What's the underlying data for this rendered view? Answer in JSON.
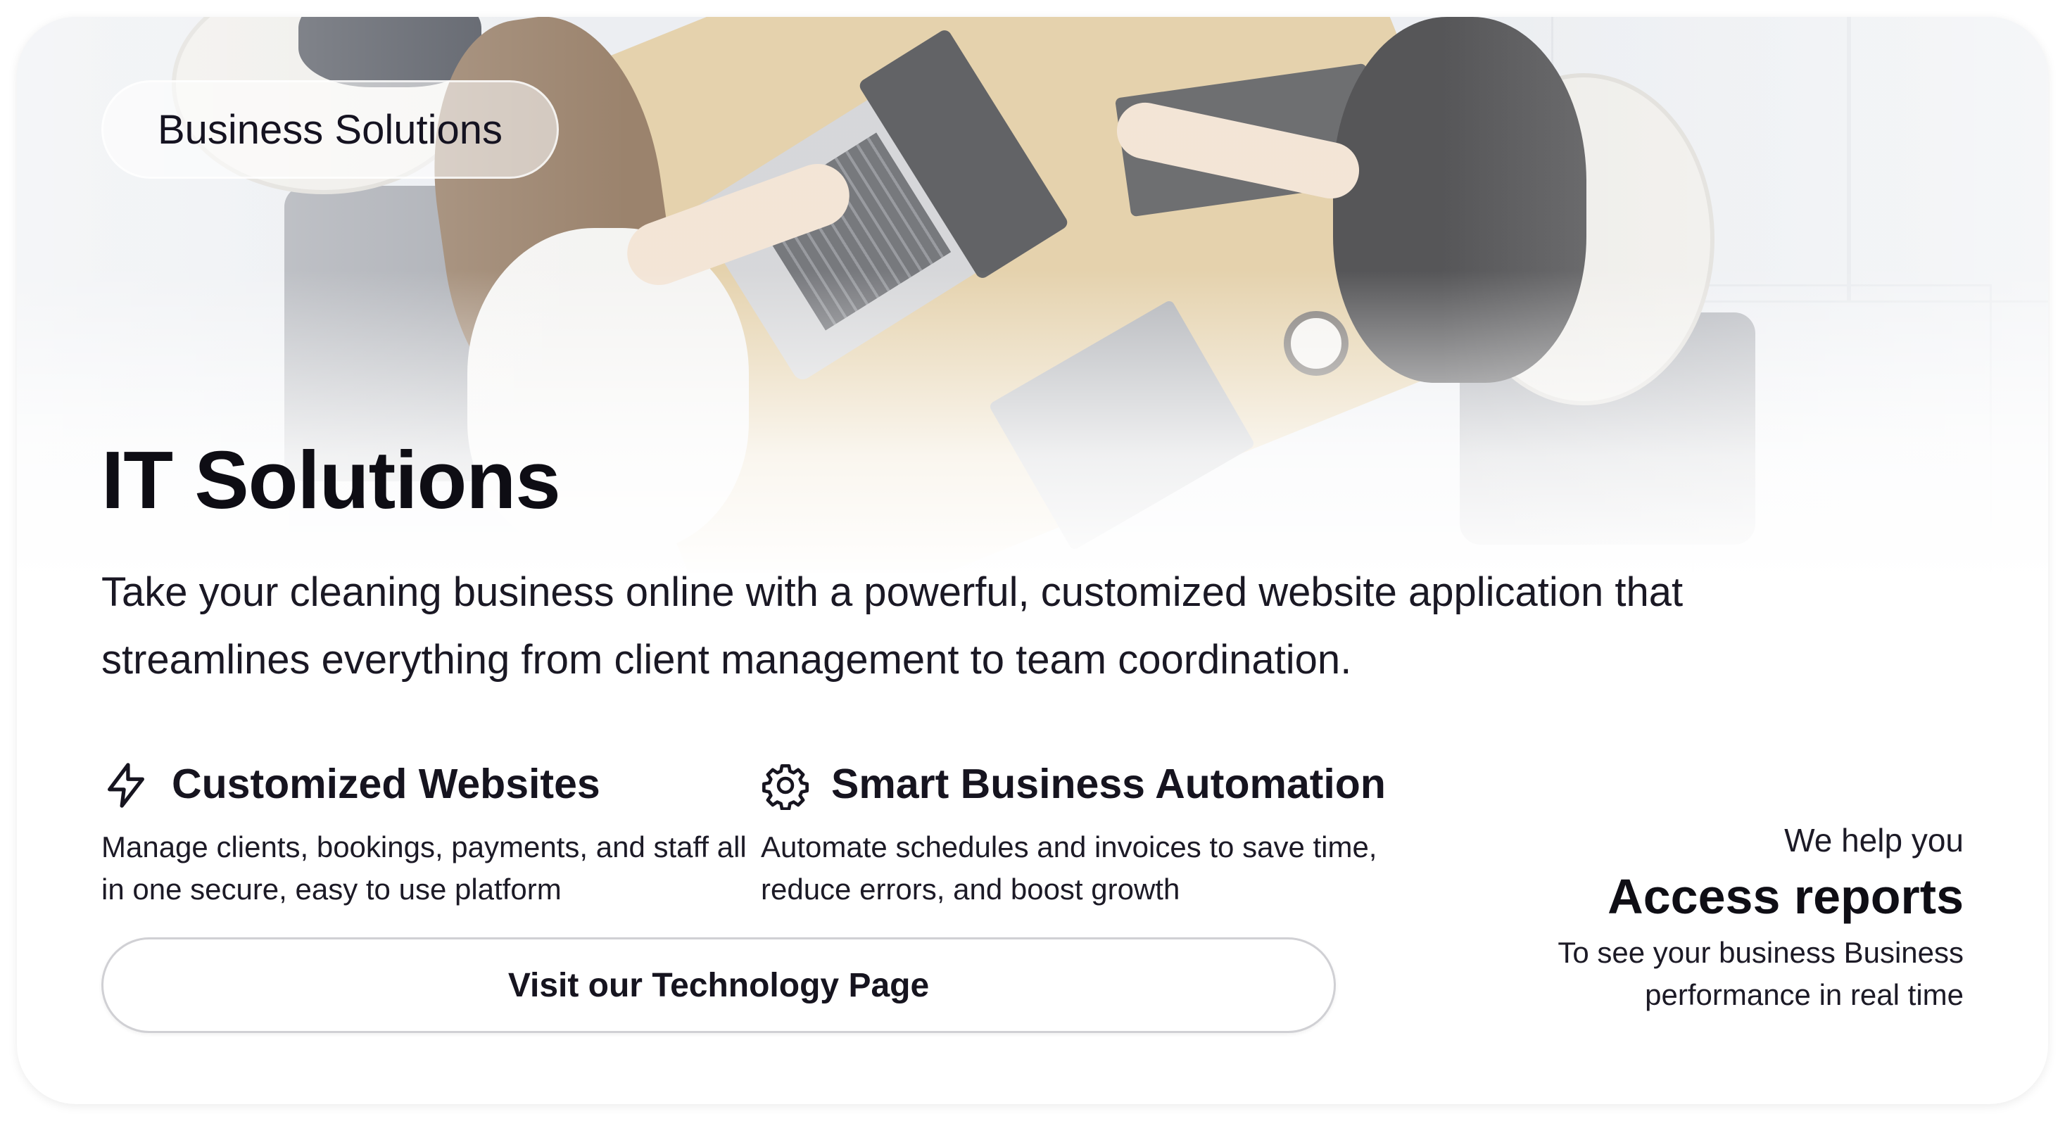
{
  "badge": {
    "label": "Business Solutions"
  },
  "hero": {
    "title": "IT Solutions",
    "description": "Take your cleaning business online with a powerful, customized website application that streamlines everything from client management to team coordination."
  },
  "features": [
    {
      "icon": "lightning-bolt-icon",
      "title": "Customized Websites",
      "description": "Manage clients, bookings, payments, and staff all in one secure, easy to use platform"
    },
    {
      "icon": "gear-icon",
      "title": "Smart Business Automation",
      "description": "Automate schedules and invoices to save time, reduce errors, and boost growth"
    }
  ],
  "cta": {
    "label": "Visit our Technology Page"
  },
  "highlight": {
    "kicker": "We help you",
    "headline": "Access reports",
    "subtext": "To see your business Business performance in real time"
  },
  "colors": {
    "text": "#14121c",
    "border": "#d0d0d4",
    "background": "#ffffff"
  }
}
